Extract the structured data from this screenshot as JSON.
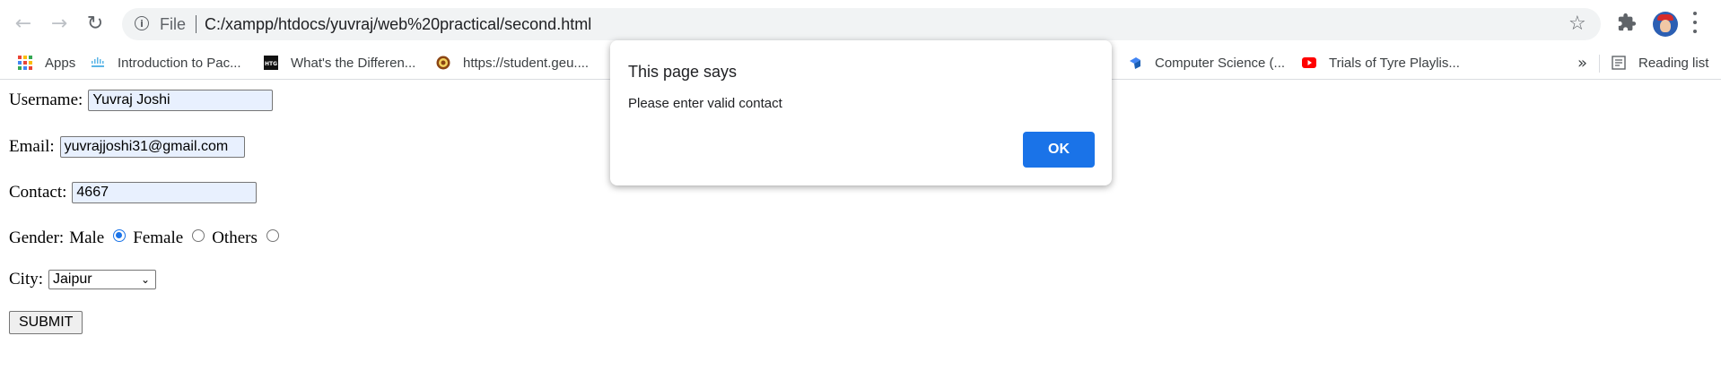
{
  "browser": {
    "url_scheme_label": "File",
    "url": "C:/xampp/htdocs/yuvraj/web%20practical/second.html",
    "bookmarks": [
      {
        "label": "Apps"
      },
      {
        "label": "Introduction to Pac..."
      },
      {
        "label": "What's the Differen..."
      },
      {
        "label": "https://student.geu...."
      },
      {
        "label": "Computer Science (..."
      },
      {
        "label": "Trials of Tyre Playlis..."
      }
    ],
    "overflow": "»",
    "reading_list": "Reading list"
  },
  "form": {
    "username_label": "Username:",
    "username_value": "Yuvraj Joshi",
    "email_label": "Email:",
    "email_value": "yuvrajjoshi31@gmail.com",
    "contact_label": "Contact:",
    "contact_value": "4667",
    "gender_label": "Gender:",
    "gender_options": [
      "Male",
      "Female",
      "Others"
    ],
    "gender_selected": "Male",
    "city_label": "City:",
    "city_value": "Jaipur",
    "submit_label": "SUBMIT"
  },
  "dialog": {
    "title": "This page says",
    "message": "Please enter valid contact",
    "ok_label": "OK"
  },
  "colors": {
    "accent": "#1a73e8",
    "autofill_bg": "#e8f0fe"
  }
}
